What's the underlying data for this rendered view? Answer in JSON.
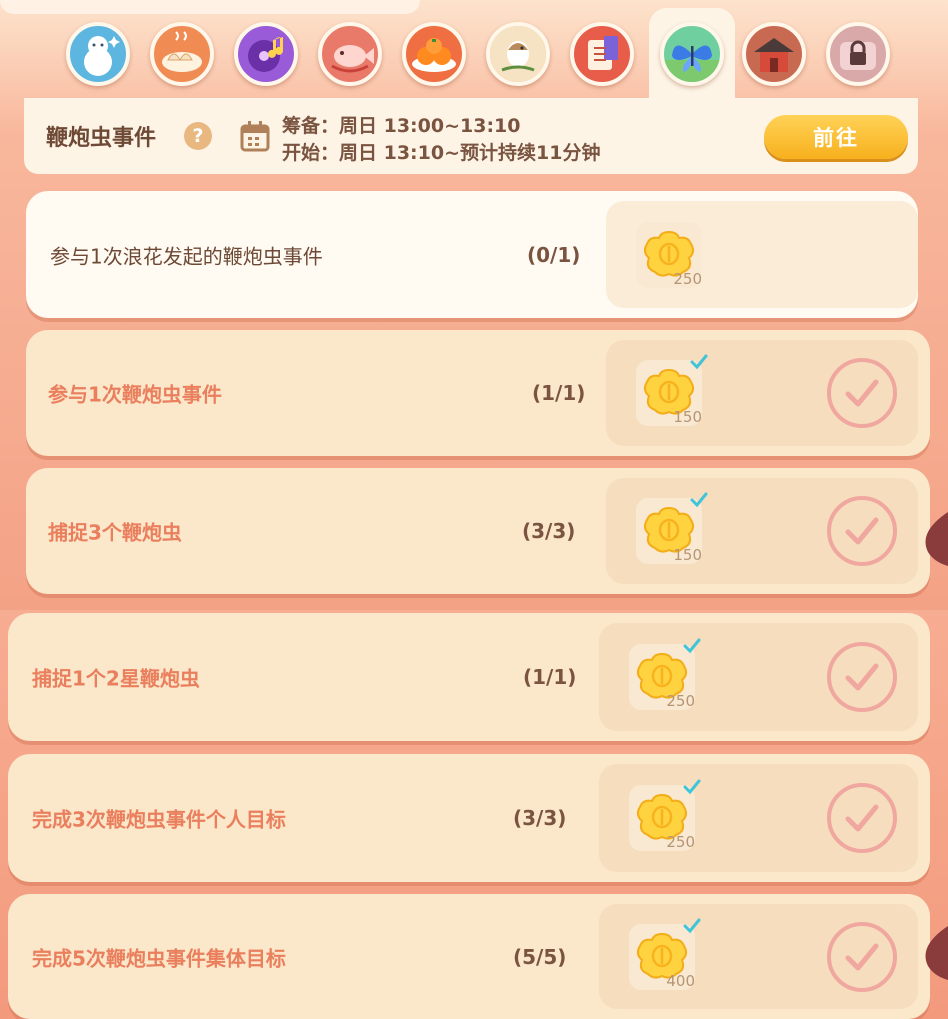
{
  "tabs": [
    {
      "icon": "snowman-icon",
      "color": "#5cb6e0"
    },
    {
      "icon": "dumplings-icon",
      "color": "#f08b54"
    },
    {
      "icon": "music-disc-icon",
      "color": "#9a5bd8"
    },
    {
      "icon": "fish-icon",
      "color": "#e97a6a"
    },
    {
      "icon": "persimmons-icon",
      "color": "#ef6e42"
    },
    {
      "icon": "bird-icon",
      "color": "#e9b77a"
    },
    {
      "icon": "music-book-icon",
      "color": "#e85c4a"
    },
    {
      "icon": "butterfly-icon",
      "color": "#6fcf9f",
      "selected": true
    },
    {
      "icon": "house-icon",
      "color": "#c86a52"
    },
    {
      "icon": "locked-icon",
      "color": "#d9a8a8"
    }
  ],
  "event": {
    "title": "鞭炮虫事件",
    "help": "?",
    "prepare_line": "筹备：周日 13:00~13:10",
    "start_line": "开始：周日 13:10~预计持续11分钟",
    "go_label": "前往"
  },
  "tasks": [
    {
      "label": "参与1次浪花发起的鞭炮虫事件",
      "progress": "(0/1)",
      "reward_qty": "250",
      "claimed": false
    },
    {
      "label": "参与1次鞭炮虫事件",
      "progress": "(1/1)",
      "reward_qty": "150",
      "claimed": true
    },
    {
      "label": "捕捉3个鞭炮虫",
      "progress": "(3/3)",
      "reward_qty": "150",
      "claimed": true
    },
    {
      "label": "捕捉1个2星鞭炮虫",
      "progress": "(1/1)",
      "reward_qty": "250",
      "claimed": true
    },
    {
      "label": "完成3次鞭炮虫事件个人目标",
      "progress": "(3/3)",
      "reward_qty": "250",
      "claimed": true
    },
    {
      "label": "完成5次鞭炮虫事件集体目标",
      "progress": "(5/5)",
      "reward_qty": "400",
      "claimed": true
    }
  ],
  "colors": {
    "accent_orange": "#ea7f5e",
    "gold_button": "#f7b01d",
    "check_pink": "#f0a7a0",
    "check_blue": "#3fc4d9"
  }
}
